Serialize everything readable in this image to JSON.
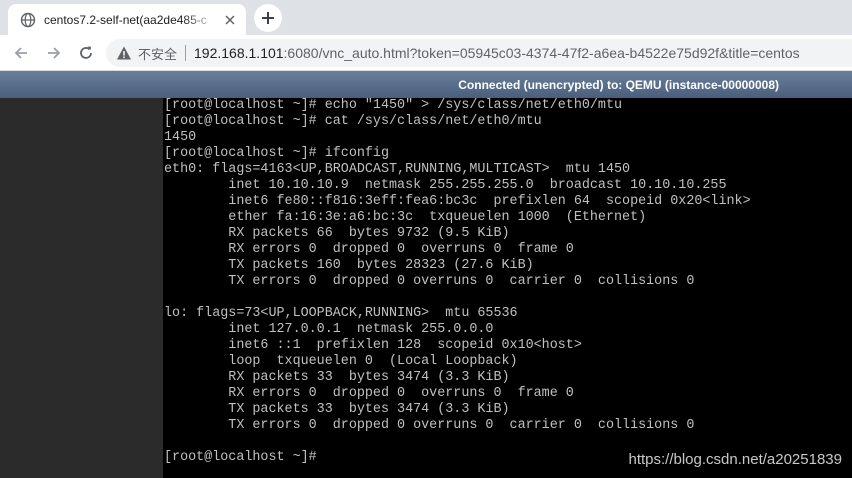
{
  "browser": {
    "tab": {
      "title": "centos7.2-self-net(aa2de485-c",
      "favicon": "globe-icon",
      "close": "close-icon"
    },
    "new_tab": "plus-icon",
    "nav": {
      "back": "back-arrow-icon",
      "forward": "forward-arrow-icon",
      "reload": "reload-icon"
    },
    "omnibox": {
      "security_icon": "warning-icon",
      "security_label": "不安全",
      "url_host": "192.168.1.101",
      "url_rest": ":6080/vnc_auto.html?token=05945c03-4374-47f2-a6ea-b4522e75d92f&title=centos"
    }
  },
  "vnc": {
    "status": "Connected (unencrypted) to: QEMU (instance-00000008)",
    "console_lines": [
      "[root@localhost ~]# echo \"1450\" > /sys/class/net/eth0/mtu",
      "[root@localhost ~]# cat /sys/class/net/eth0/mtu",
      "1450",
      "[root@localhost ~]# ifconfig",
      "eth0: flags=4163<UP,BROADCAST,RUNNING,MULTICAST>  mtu 1450",
      "        inet 10.10.10.9  netmask 255.255.255.0  broadcast 10.10.10.255",
      "        inet6 fe80::f816:3eff:fea6:bc3c  prefixlen 64  scopeid 0x20<link>",
      "        ether fa:16:3e:a6:bc:3c  txqueuelen 1000  (Ethernet)",
      "        RX packets 66  bytes 9732 (9.5 KiB)",
      "        RX errors 0  dropped 0  overruns 0  frame 0",
      "        TX packets 160  bytes 28323 (27.6 KiB)",
      "        TX errors 0  dropped 0 overruns 0  carrier 0  collisions 0",
      "",
      "lo: flags=73<UP,LOOPBACK,RUNNING>  mtu 65536",
      "        inet 127.0.0.1  netmask 255.0.0.0",
      "        inet6 ::1  prefixlen 128  scopeid 0x10<host>",
      "        loop  txqueuelen 0  (Local Loopback)",
      "        RX packets 33  bytes 3474 (3.3 KiB)",
      "        RX errors 0  dropped 0  overruns 0  frame 0",
      "        TX packets 33  bytes 3474 (3.3 KiB)",
      "        TX errors 0  dropped 0 overruns 0  carrier 0  collisions 0",
      "",
      "[root@localhost ~]#"
    ]
  },
  "watermark": "https://blog.csdn.net/a20251839",
  "colors": {
    "console_bg": "#000000",
    "console_text": "#c0c0c0",
    "status_bar": "#56698a",
    "tabstrip": "#dee1e6"
  }
}
